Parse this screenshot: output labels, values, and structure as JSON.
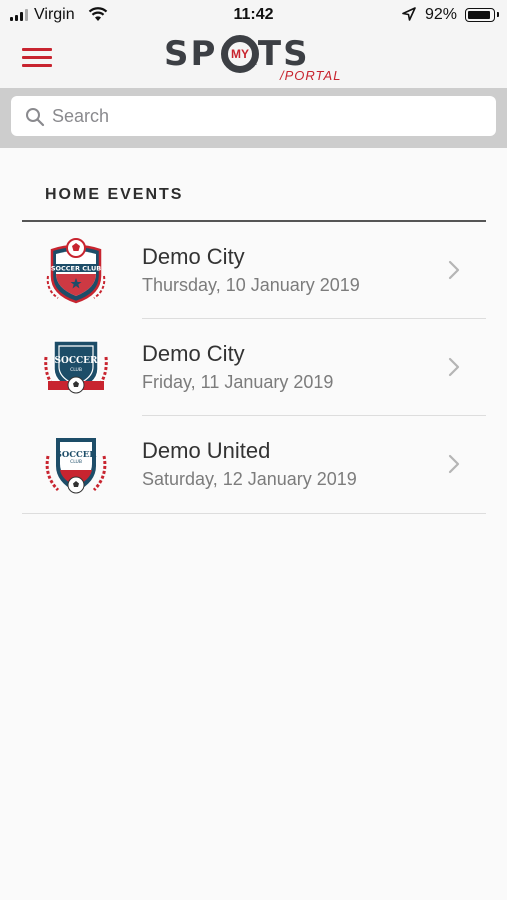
{
  "status_bar": {
    "carrier": "Virgin",
    "time": "11:42",
    "battery": "92%"
  },
  "header": {
    "logo_main": "SP RTS",
    "logo_my": "MY",
    "logo_portal": "/PORTAL"
  },
  "search": {
    "placeholder": "Search"
  },
  "section": {
    "title": "HOME EVENTS"
  },
  "events": [
    {
      "team": "Demo City",
      "date": "Thursday, 10 January 2019",
      "crest_icon": "soccer-club-crest-icon"
    },
    {
      "team": "Demo City",
      "date": "Friday, 11 January 2019",
      "crest_icon": "soccer-crest-banner-icon"
    },
    {
      "team": "Demo United",
      "date": "Saturday, 12 January 2019",
      "crest_icon": "soccer-club-laurel-crest-icon"
    }
  ],
  "colors": {
    "brand_red": "#c8242f",
    "brand_dark": "#3c3f44",
    "crest_navy": "#1d4d68"
  }
}
